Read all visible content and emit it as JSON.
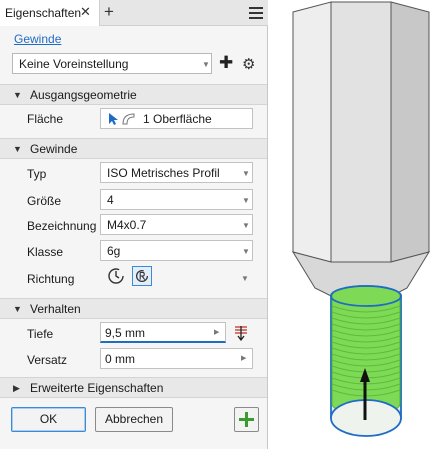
{
  "tabs": {
    "properties_label": "Eigenschaften",
    "close_glyph": "✕",
    "add_glyph": "+"
  },
  "subtab": {
    "label": "Gewinde"
  },
  "preset": {
    "value": "Keine Voreinstellung"
  },
  "sections": {
    "input_geometry": {
      "title": "Ausgangsgeometrie"
    },
    "thread": {
      "title": "Gewinde"
    },
    "behavior": {
      "title": "Verhalten"
    },
    "advanced": {
      "title": "Erweiterte Eigenschaften"
    }
  },
  "face": {
    "label": "Fläche",
    "value": "1 Oberfläche"
  },
  "thread": {
    "type": {
      "label": "Typ",
      "value": "ISO Metrisches Profil"
    },
    "size": {
      "label": "Größe",
      "value": "4"
    },
    "designation": {
      "label": "Bezeichnung",
      "value": "M4x0.7"
    },
    "class": {
      "label": "Klasse",
      "value": "6g"
    },
    "direction": {
      "label": "Richtung"
    }
  },
  "behavior": {
    "depth": {
      "label": "Tiefe",
      "value": "9,5 mm"
    },
    "offset": {
      "label": "Versatz",
      "value": "0 mm"
    }
  },
  "buttons": {
    "ok": "OK",
    "cancel": "Abbrechen"
  },
  "colors": {
    "accent": "#1f6cc4",
    "thread_green": "#7ed957",
    "edge_blue": "#1f6cc4"
  }
}
